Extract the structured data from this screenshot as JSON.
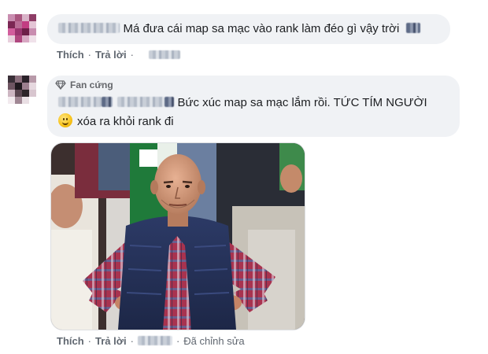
{
  "comment1": {
    "text": "Má đưa cái map sa mạc vào rank làm đéo gì vậy trời",
    "actions": {
      "like": "Thích",
      "reply": "Trả lời"
    }
  },
  "comment2": {
    "badge": "Fan cứng",
    "text_line1": "Bức xúc map sa mạc lắm rồi. TỨC TÍM NGƯỜI",
    "text_line2": "xóa ra khỏi rank đi",
    "emoji": "slightly-smiling-face",
    "attachment": "photo of a bald man in a navy puffer vest and plaid shirt standing with hands on hips",
    "actions": {
      "like": "Thích",
      "reply": "Trả lời",
      "edited": "Đã chỉnh sửa"
    }
  },
  "colors": {
    "bubble": "#f0f2f5",
    "action_text": "#606770",
    "badge_text": "#65676b"
  }
}
